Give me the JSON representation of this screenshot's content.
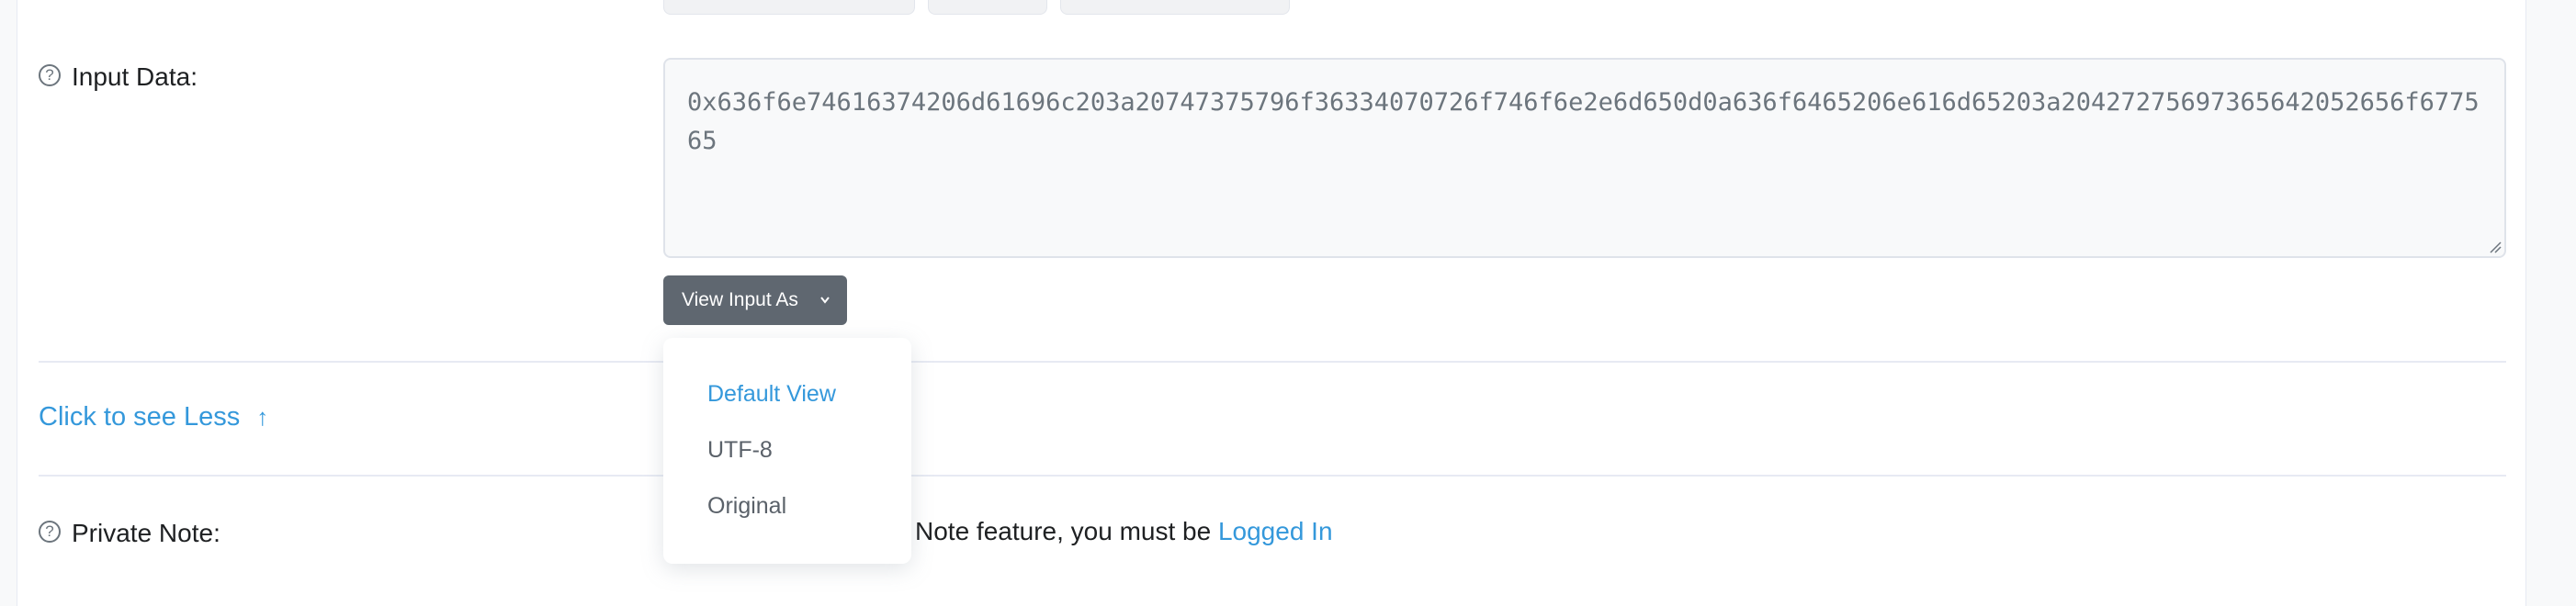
{
  "input_data": {
    "label": "Input Data:",
    "value": "0x636f6e74616374206d61696c203a20747375796f36334070726f746f6e2e6d650d0a636f6465206e616d65203a20427275697365642052656f677565",
    "view_button_label": "View Input As"
  },
  "dropdown": {
    "items": [
      {
        "label": "Default View",
        "active": true
      },
      {
        "label": "UTF-8",
        "active": false
      },
      {
        "label": "Original",
        "active": false
      }
    ]
  },
  "see_less": {
    "label": "Click to see Less",
    "arrow": "↑"
  },
  "private_note": {
    "label": "Private Note:",
    "text_partial": "Note feature, you must be ",
    "login_link": "Logged In"
  },
  "icons": {
    "help": "?",
    "chevron": "⌄"
  },
  "colors": {
    "link": "#3498db",
    "button_bg": "#5f6770"
  }
}
